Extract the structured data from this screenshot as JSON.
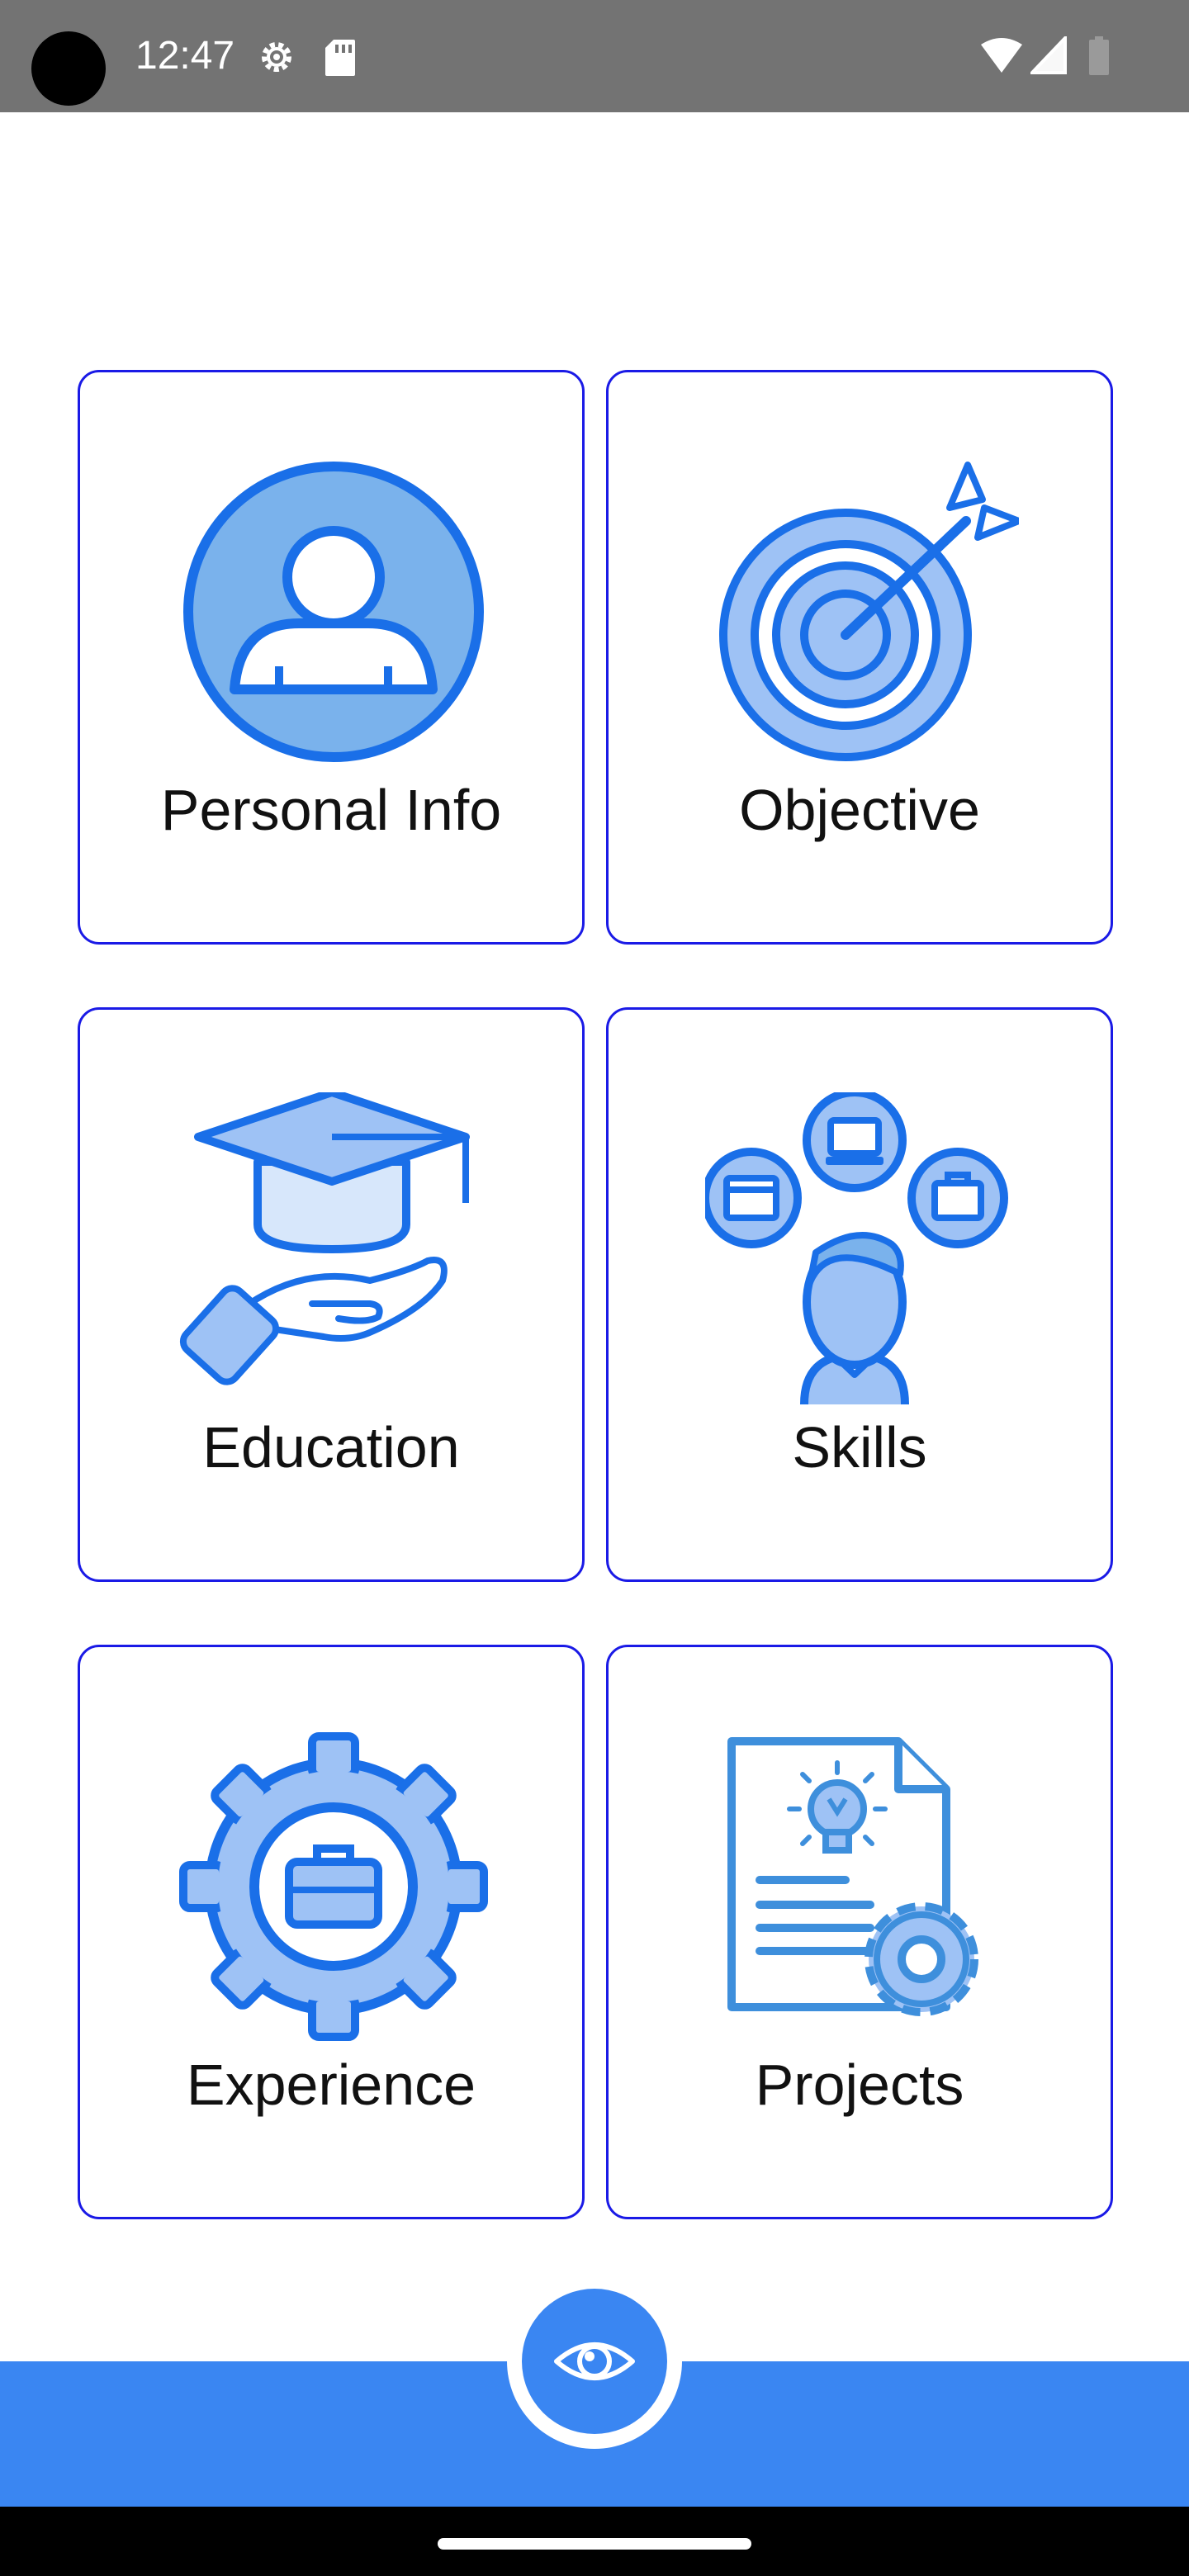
{
  "status_bar": {
    "time": "12:47",
    "icons": [
      "settings-gear-icon",
      "sd-card-icon",
      "wifi-icon",
      "signal-icon",
      "battery-icon"
    ]
  },
  "cards": [
    {
      "label": "Personal Info",
      "icon": "person-icon"
    },
    {
      "label": "Objective",
      "icon": "target-icon"
    },
    {
      "label": "Education",
      "icon": "graduation-cap-icon"
    },
    {
      "label": "Skills",
      "icon": "skills-icon"
    },
    {
      "label": "Experience",
      "icon": "gear-briefcase-icon"
    },
    {
      "label": "Projects",
      "icon": "document-gear-icon"
    }
  ],
  "bottom_bar": {
    "action_icon": "eye-icon"
  },
  "colors": {
    "card_border": "#1a1ae6",
    "icon_blue": "#1a6fe8",
    "icon_fill": "#9ec2f5",
    "icon_fill_dark": "#7ab2ec",
    "bar_blue": "#3a86f2",
    "status_bar": "#737373"
  }
}
